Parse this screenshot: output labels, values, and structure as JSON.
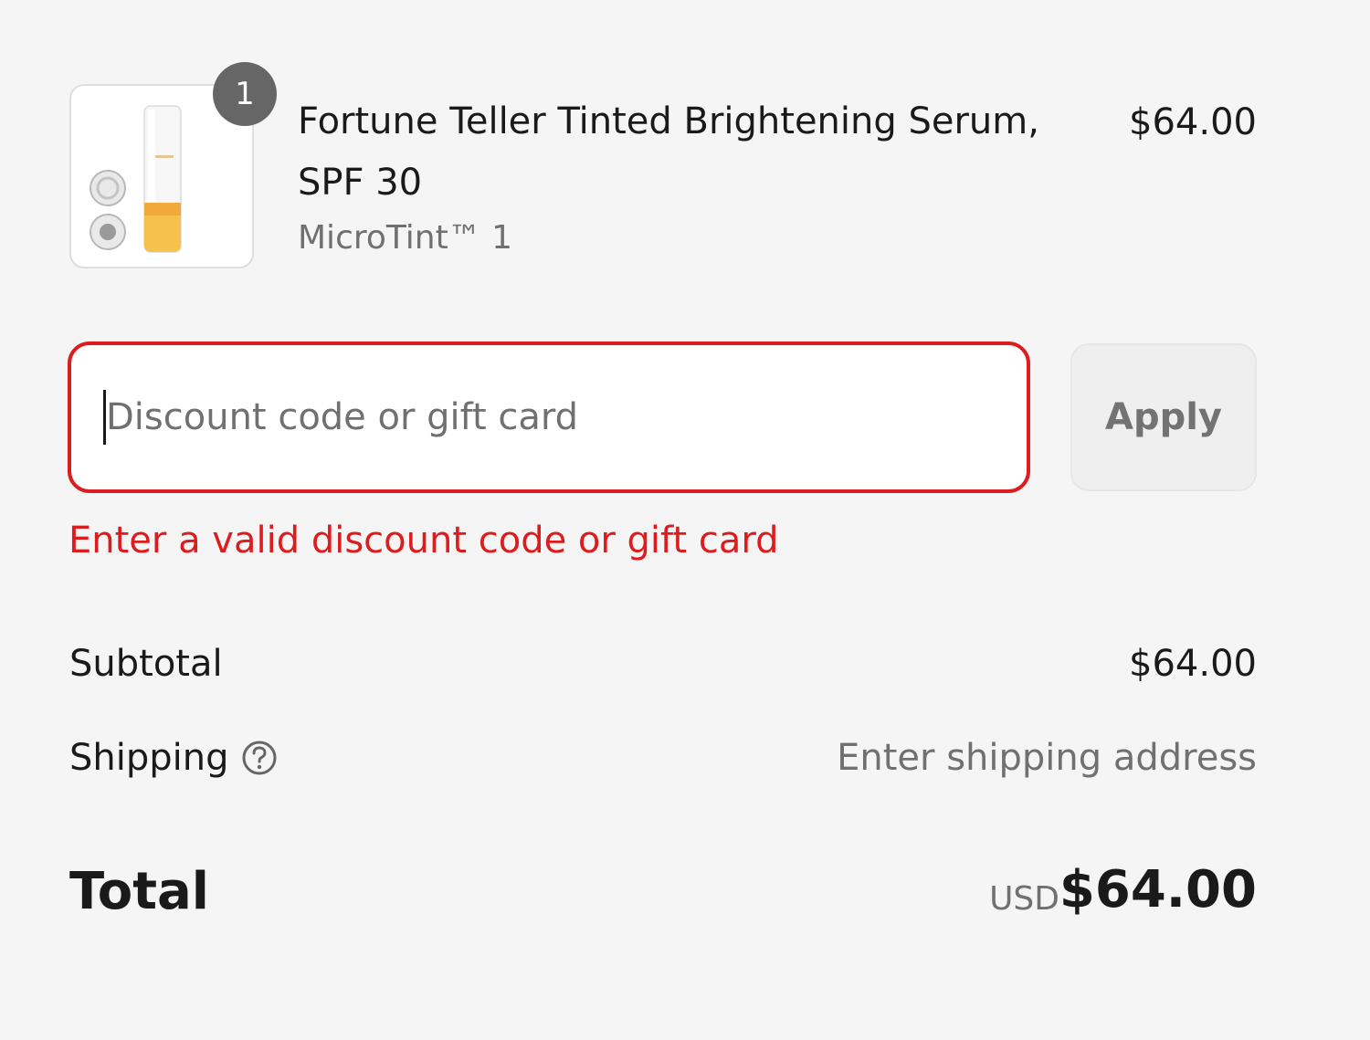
{
  "cart_item": {
    "quantity": "1",
    "name": "Fortune Teller Tinted Brightening Serum, SPF 30",
    "variant": "MicroTint™ 1",
    "price": "$64.00",
    "image_icon": "serum-bottle-product-image"
  },
  "discount": {
    "placeholder": "Discount code or gift card",
    "value": "",
    "apply_label": "Apply",
    "error": "Enter a valid discount code or gift card"
  },
  "summary": {
    "subtotal_label": "Subtotal",
    "subtotal_value": "$64.00",
    "shipping_label": "Shipping",
    "shipping_value": "Enter shipping address",
    "shipping_help_icon": "question-circle-icon",
    "total_label": "Total",
    "total_currency": "USD",
    "total_value": "$64.00"
  },
  "colors": {
    "background": "#f5f5f5",
    "error": "#dd1d1d",
    "text_primary": "#1a1a1a",
    "text_secondary": "#707070",
    "badge": "#666666"
  }
}
